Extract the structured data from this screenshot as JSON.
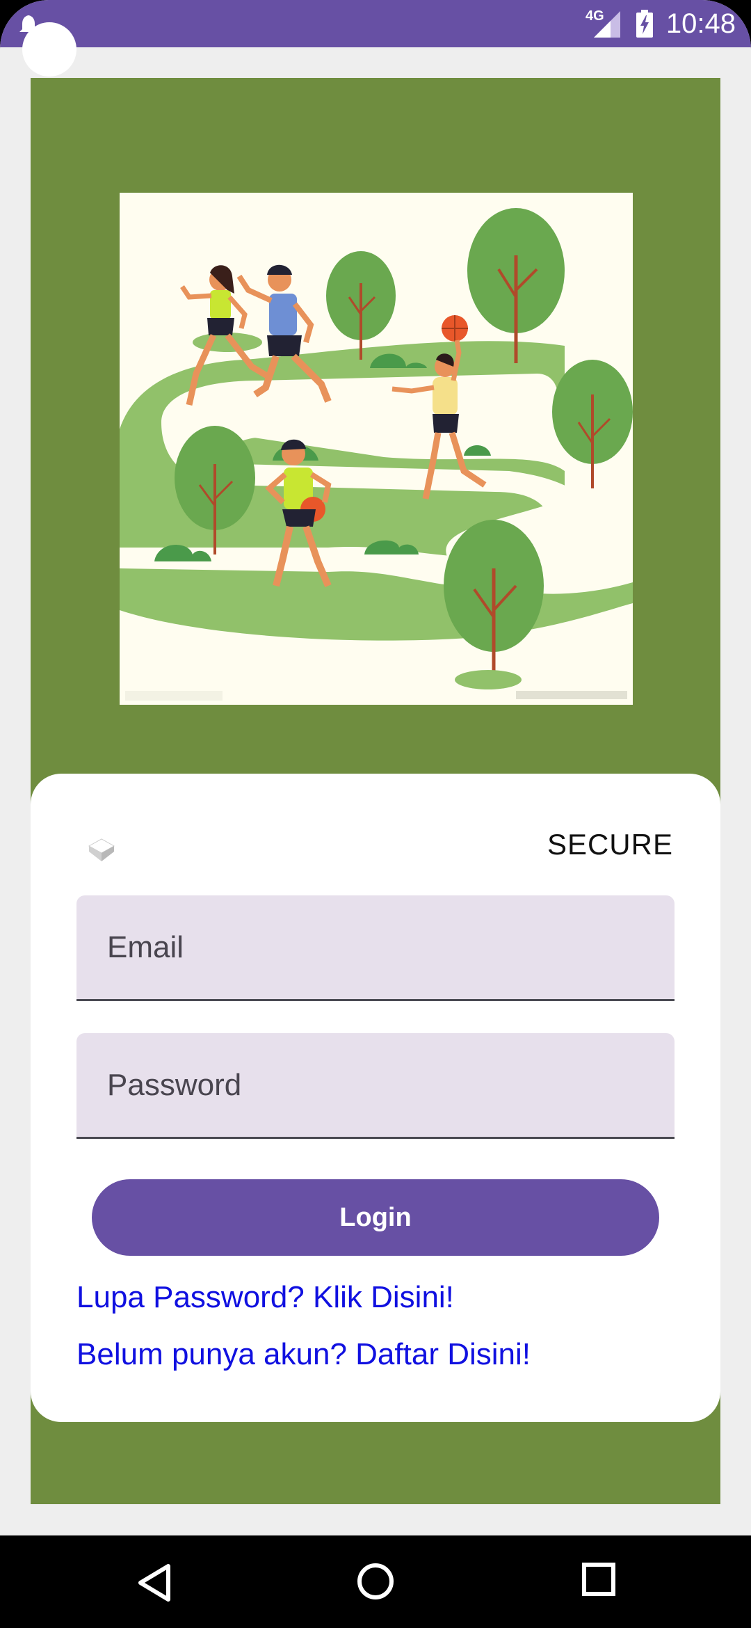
{
  "status_bar": {
    "time": "10:48",
    "network": "4G",
    "icons": [
      "notification-icon",
      "signal-icon",
      "battery-charging-icon"
    ],
    "color": "#6750a4"
  },
  "hero": {
    "image": "park-runners-illustration",
    "background_color": "#6f8d3f"
  },
  "login": {
    "logo_icon": "app-logo-icon",
    "brand": "SECURE",
    "email_placeholder": "Email",
    "password_placeholder": "Password",
    "login_label": "Login",
    "forgot_link": "Lupa Password? Klik Disini!",
    "register_link": "Belum punya akun? Daftar Disini!",
    "accent_color": "#6750a4",
    "link_color": "#1010e0",
    "field_color": "#e7e0ec"
  },
  "nav_bar": {
    "icons": [
      "back-icon",
      "home-icon",
      "recents-icon"
    ]
  }
}
